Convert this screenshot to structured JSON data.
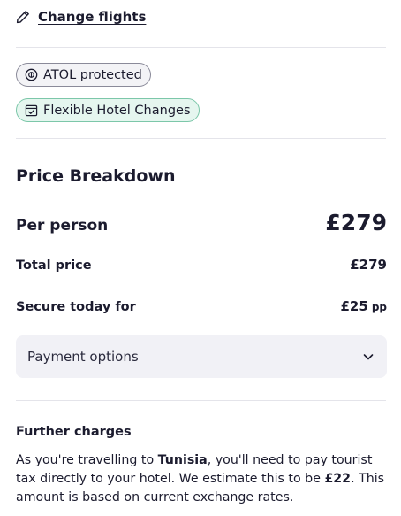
{
  "change_flights": {
    "label": "Change flights"
  },
  "badges": {
    "atol": {
      "label": "ATOL protected",
      "icon": "atol-shield-icon"
    },
    "flexible": {
      "label": "Flexible Hotel Changes",
      "icon": "calendar-check-icon"
    }
  },
  "price_breakdown": {
    "title": "Price Breakdown",
    "per_person": {
      "label": "Per person",
      "value": "£279"
    },
    "total_price": {
      "label": "Total price",
      "value": "£279"
    },
    "secure_today": {
      "label": "Secure today for",
      "value": "£25",
      "suffix": "pp"
    }
  },
  "payment_options": {
    "label": "Payment options",
    "icon": "chevron-down-icon"
  },
  "further_charges": {
    "title": "Further charges",
    "text_1": "As you're travelling to ",
    "destination": "Tunisia",
    "text_2": ", you'll need to pay tourist tax directly to your hotel. We estimate this to be ",
    "amount": "£22",
    "text_3": ". This amount is based on current exchange rates."
  },
  "colors": {
    "text": "#1b1b2e",
    "atol_bg": "#f3f3f6",
    "flexible_bg": "#e5f6ef",
    "flexible_border": "#7cc7a9",
    "panel_bg": "#f1f1f6"
  }
}
